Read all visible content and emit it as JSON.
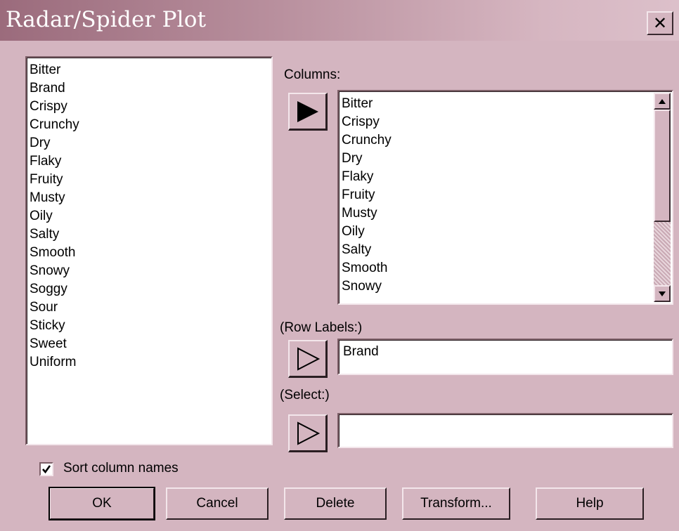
{
  "window": {
    "title": "Radar/Spider Plot",
    "close_label": "X"
  },
  "available_columns": [
    "Bitter",
    "Brand",
    "Crispy",
    "Crunchy",
    "Dry",
    "Flaky",
    "Fruity",
    "Musty",
    "Oily",
    "Salty",
    "Smooth",
    "Snowy",
    "Soggy",
    "Sour",
    "Sticky",
    "Sweet",
    "Uniform"
  ],
  "columns": {
    "label": "Columns:",
    "items": [
      "Bitter",
      "Crispy",
      "Crunchy",
      "Dry",
      "Flaky",
      "Fruity",
      "Musty",
      "Oily",
      "Salty",
      "Smooth",
      "Snowy"
    ]
  },
  "row_labels": {
    "label": "(Row Labels:)",
    "value": "Brand"
  },
  "select": {
    "label": "(Select:)",
    "value": ""
  },
  "sort": {
    "label": "Sort column names",
    "checked": true
  },
  "buttons": {
    "ok": "OK",
    "cancel": "Cancel",
    "delete": "Delete",
    "transform": "Transform...",
    "help": "Help"
  },
  "colors": {
    "dialog_bg": "#d4b5c0",
    "title_gradient_start": "#9b6b7c",
    "title_gradient_end": "#dcc0ca"
  }
}
